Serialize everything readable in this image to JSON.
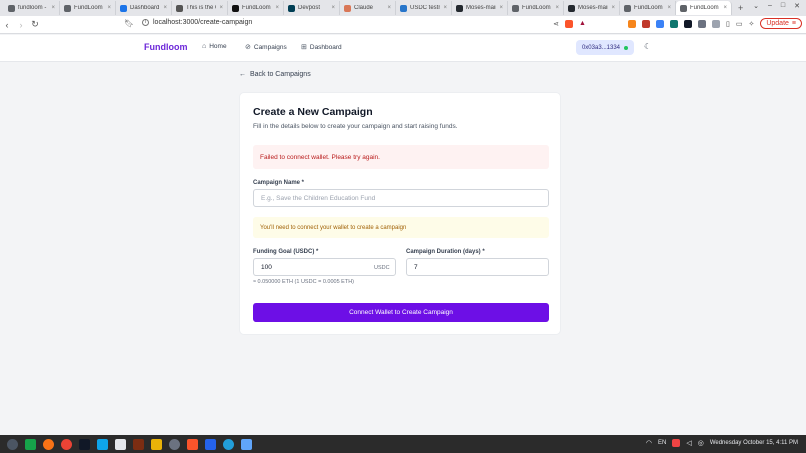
{
  "browser": {
    "tabs": [
      {
        "title": "fundloom - Cr",
        "color": "#5f6368"
      },
      {
        "title": "FundLoom dapp",
        "color": "#5f6368"
      },
      {
        "title": "Dashboard - A",
        "color": "#1a73e8"
      },
      {
        "title": "This is the Ca",
        "color": "#555555"
      },
      {
        "title": "FundLoom (@f",
        "color": "#111111"
      },
      {
        "title": "Devpost",
        "color": "#003e54"
      },
      {
        "title": "Claude",
        "color": "#d97757"
      },
      {
        "title": "USDC testnet",
        "color": "#2775ca"
      },
      {
        "title": "Moses-main/f",
        "color": "#24292f"
      },
      {
        "title": "FundLoom dapp",
        "color": "#5f6368"
      },
      {
        "title": "Moses-main/f",
        "color": "#24292f"
      },
      {
        "title": "FundLoom dapp",
        "color": "#5f6368"
      },
      {
        "title": "FundLoom",
        "color": "#5f6368",
        "active": true
      }
    ],
    "url": "localhost:3000/create-campaign",
    "update_label": "Update"
  },
  "header": {
    "brand": "Fundloom",
    "nav": {
      "home": "Home",
      "campaigns": "Campaigns",
      "dashboard": "Dashboard"
    },
    "wallet_address": "0x03a3...1334",
    "wallet_status_color": "#22c55e"
  },
  "page": {
    "back_label": "Back to Campaigns",
    "title": "Create a New Campaign",
    "subtitle": "Fill in the details below to create your campaign and start raising funds.",
    "error_message": "Failed to connect wallet. Please try again.",
    "campaign_name_label": "Campaign Name *",
    "campaign_name_placeholder": "E.g., Save the Children Education Fund",
    "campaign_name_value": "",
    "wallet_warning": "You'll need to connect your wallet to create a campaign",
    "funding_goal_label": "Funding Goal (USDC) *",
    "funding_goal_value": "100",
    "funding_goal_unit": "USDC",
    "duration_label": "Campaign Duration (days) *",
    "duration_value": "7",
    "conversion_hint": "≈ 0.050000 ETH (1 USDC = 0.0005 ETH)",
    "submit_label": "Connect Wallet to Create Campaign",
    "accent_color": "#6d0fe6"
  },
  "taskbar": {
    "language": "EN",
    "datetime": "Wednesday October 15, 4:11 PM"
  }
}
